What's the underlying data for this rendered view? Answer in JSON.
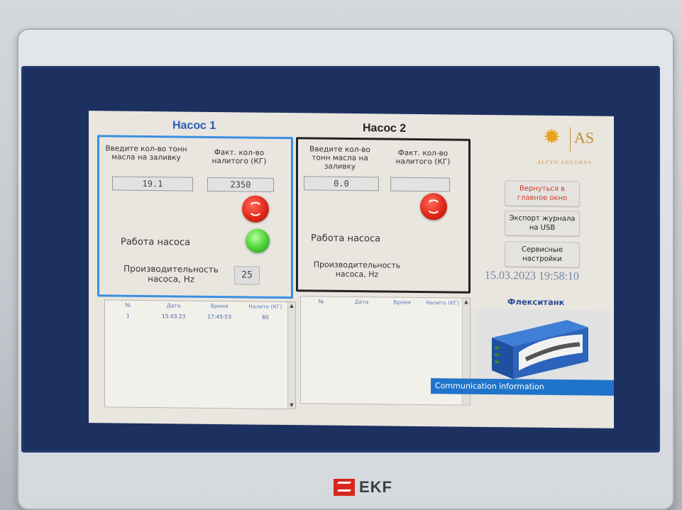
{
  "pump1": {
    "title": "Насос 1",
    "enter_tons_label": "Введите кол-во тонн масла на заливку",
    "enter_tons_value": "19.1",
    "actual_label": "Факт. кол-во налитого (КГ)",
    "actual_value": "2350",
    "status_label": "Работа насоса",
    "status_lamp": "on",
    "perf_label": "Производительность насоса, Hz",
    "perf_value": "25"
  },
  "pump2": {
    "title": "Насос 2",
    "enter_tons_label": "Введите кол-во тонн масла на заливку",
    "enter_tons_value": "0.0",
    "actual_label": "Факт. кол-во налитого (КГ)",
    "actual_value": "",
    "status_label": "Работа насоса",
    "perf_label": "Производительность насоса, Hz"
  },
  "brand": {
    "mark": "AS",
    "subtitle": "ALTYN SHYGHYS",
    "icon": "sun-icon"
  },
  "buttons": {
    "back_to_main": "Вернуться в главное окно",
    "export_usb": "Экспорт журнала на USB",
    "service": "Сервисные настройки"
  },
  "datetime": "15.03.2023 19:58:10",
  "flexitank_title": "Флекситанк",
  "table1": {
    "headers": [
      "№",
      "Дата",
      "Время",
      "Налито (КГ)"
    ],
    "rows": [
      [
        "1",
        "15.03.23",
        "17:45:53",
        "60"
      ]
    ]
  },
  "table2": {
    "headers": [
      "№",
      "Дата",
      "Время",
      "Налито (КГ)"
    ],
    "rows": []
  },
  "communication": "Communication information",
  "device_brand": "EKF",
  "colors": {
    "accent_blue": "#3a8fe0",
    "stop_red": "#e0281a",
    "lamp_green": "#4fd43a"
  }
}
